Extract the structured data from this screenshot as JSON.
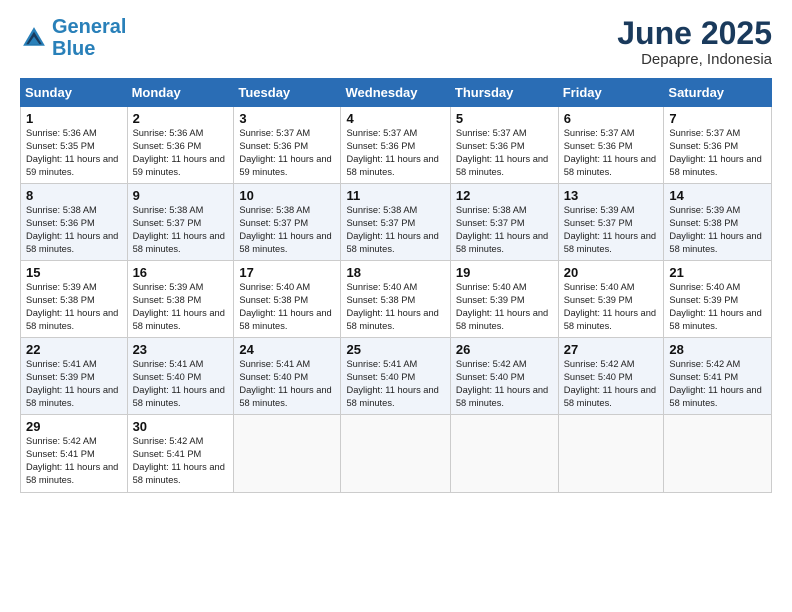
{
  "logo": {
    "line1": "General",
    "line2": "Blue"
  },
  "title": "June 2025",
  "location": "Depapre, Indonesia",
  "days_header": [
    "Sunday",
    "Monday",
    "Tuesday",
    "Wednesday",
    "Thursday",
    "Friday",
    "Saturday"
  ],
  "weeks": [
    [
      {
        "day": "1",
        "sunrise": "5:36 AM",
        "sunset": "5:35 PM",
        "daylight": "11 hours and 59 minutes."
      },
      {
        "day": "2",
        "sunrise": "5:36 AM",
        "sunset": "5:36 PM",
        "daylight": "11 hours and 59 minutes."
      },
      {
        "day": "3",
        "sunrise": "5:37 AM",
        "sunset": "5:36 PM",
        "daylight": "11 hours and 59 minutes."
      },
      {
        "day": "4",
        "sunrise": "5:37 AM",
        "sunset": "5:36 PM",
        "daylight": "11 hours and 58 minutes."
      },
      {
        "day": "5",
        "sunrise": "5:37 AM",
        "sunset": "5:36 PM",
        "daylight": "11 hours and 58 minutes."
      },
      {
        "day": "6",
        "sunrise": "5:37 AM",
        "sunset": "5:36 PM",
        "daylight": "11 hours and 58 minutes."
      },
      {
        "day": "7",
        "sunrise": "5:37 AM",
        "sunset": "5:36 PM",
        "daylight": "11 hours and 58 minutes."
      }
    ],
    [
      {
        "day": "8",
        "sunrise": "5:38 AM",
        "sunset": "5:36 PM",
        "daylight": "11 hours and 58 minutes."
      },
      {
        "day": "9",
        "sunrise": "5:38 AM",
        "sunset": "5:37 PM",
        "daylight": "11 hours and 58 minutes."
      },
      {
        "day": "10",
        "sunrise": "5:38 AM",
        "sunset": "5:37 PM",
        "daylight": "11 hours and 58 minutes."
      },
      {
        "day": "11",
        "sunrise": "5:38 AM",
        "sunset": "5:37 PM",
        "daylight": "11 hours and 58 minutes."
      },
      {
        "day": "12",
        "sunrise": "5:38 AM",
        "sunset": "5:37 PM",
        "daylight": "11 hours and 58 minutes."
      },
      {
        "day": "13",
        "sunrise": "5:39 AM",
        "sunset": "5:37 PM",
        "daylight": "11 hours and 58 minutes."
      },
      {
        "day": "14",
        "sunrise": "5:39 AM",
        "sunset": "5:38 PM",
        "daylight": "11 hours and 58 minutes."
      }
    ],
    [
      {
        "day": "15",
        "sunrise": "5:39 AM",
        "sunset": "5:38 PM",
        "daylight": "11 hours and 58 minutes."
      },
      {
        "day": "16",
        "sunrise": "5:39 AM",
        "sunset": "5:38 PM",
        "daylight": "11 hours and 58 minutes."
      },
      {
        "day": "17",
        "sunrise": "5:40 AM",
        "sunset": "5:38 PM",
        "daylight": "11 hours and 58 minutes."
      },
      {
        "day": "18",
        "sunrise": "5:40 AM",
        "sunset": "5:38 PM",
        "daylight": "11 hours and 58 minutes."
      },
      {
        "day": "19",
        "sunrise": "5:40 AM",
        "sunset": "5:39 PM",
        "daylight": "11 hours and 58 minutes."
      },
      {
        "day": "20",
        "sunrise": "5:40 AM",
        "sunset": "5:39 PM",
        "daylight": "11 hours and 58 minutes."
      },
      {
        "day": "21",
        "sunrise": "5:40 AM",
        "sunset": "5:39 PM",
        "daylight": "11 hours and 58 minutes."
      }
    ],
    [
      {
        "day": "22",
        "sunrise": "5:41 AM",
        "sunset": "5:39 PM",
        "daylight": "11 hours and 58 minutes."
      },
      {
        "day": "23",
        "sunrise": "5:41 AM",
        "sunset": "5:40 PM",
        "daylight": "11 hours and 58 minutes."
      },
      {
        "day": "24",
        "sunrise": "5:41 AM",
        "sunset": "5:40 PM",
        "daylight": "11 hours and 58 minutes."
      },
      {
        "day": "25",
        "sunrise": "5:41 AM",
        "sunset": "5:40 PM",
        "daylight": "11 hours and 58 minutes."
      },
      {
        "day": "26",
        "sunrise": "5:42 AM",
        "sunset": "5:40 PM",
        "daylight": "11 hours and 58 minutes."
      },
      {
        "day": "27",
        "sunrise": "5:42 AM",
        "sunset": "5:40 PM",
        "daylight": "11 hours and 58 minutes."
      },
      {
        "day": "28",
        "sunrise": "5:42 AM",
        "sunset": "5:41 PM",
        "daylight": "11 hours and 58 minutes."
      }
    ],
    [
      {
        "day": "29",
        "sunrise": "5:42 AM",
        "sunset": "5:41 PM",
        "daylight": "11 hours and 58 minutes."
      },
      {
        "day": "30",
        "sunrise": "5:42 AM",
        "sunset": "5:41 PM",
        "daylight": "11 hours and 58 minutes."
      },
      null,
      null,
      null,
      null,
      null
    ]
  ],
  "labels": {
    "sunrise": "Sunrise: ",
    "sunset": "Sunset: ",
    "daylight": "Daylight: "
  }
}
